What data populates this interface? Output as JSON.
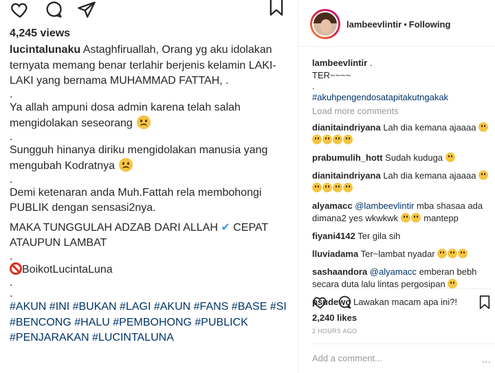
{
  "left": {
    "views": "4,245 views",
    "caption": {
      "username": "lucintalunaku",
      "p1": "Astaghfiruallah, Orang yg aku idolakan ternyata memang benar terlahir berjenis kelamin LAKI-LAKI yang bernama MUHAMMAD FATTAH, .",
      "p2": "Ya allah ampuni dosa admin karena telah salah mengidolakan seseorang",
      "p3": "Sungguh hinanya diriku mengidolakan manusia yang mengubah Kodratnya",
      "p4": "Demi ketenaran anda Muh.Fattah rela membohongi PUBLIK dengan sensasi2nya.",
      "p5a": "MAKA TUNGGULAH ADZAB DARI ALLAH",
      "p5b": "CEPAT ATAUPUN LAMBAT",
      "p6": "BoikotLucintaLuna",
      "dot": ".",
      "hashtags": "#AKUN #INI #BUKAN #LAGI #AKUN #FANS #BASE #SI #BENCONG #HALU #PEMBOHONG #PUBLICK #PENJARAKAN #LUCINTALUNA"
    },
    "icons": [
      "heart-icon",
      "comment-icon",
      "share-icon",
      "bookmark-icon"
    ]
  },
  "right": {
    "header": {
      "username": "lambeevlintir",
      "separator": "•",
      "following": "Following"
    },
    "caption": {
      "username": "lambeevlintir",
      "after_name": ".",
      "line2": "TER~~~~",
      "dot": ".",
      "hashtag": "#akuhpengendosatapitakutngakak"
    },
    "load_more": "Load more comments",
    "comments": [
      {
        "user": "dianitaindriyana",
        "text": "Lah dia kemana ajaaaa"
      },
      {
        "user": "prabumulih_hott",
        "text": "Sudah kuduga"
      },
      {
        "user": "dianitaindriyana",
        "text": "Lah dia kemana ajaaaa"
      },
      {
        "user": "alyamacc",
        "mention": "@lambeevlintir",
        "text": "mba shasaa ada dimana2 yes wkwkwk",
        "text2": "mantepp"
      },
      {
        "user": "fiyani4142",
        "text": "Ter gila sih"
      },
      {
        "user": "lluviadama",
        "text": "Ter~lambat nyadar"
      },
      {
        "user": "sashaandora",
        "mention": "@alyamacc",
        "text": "emberan bebh secara duta lalu lintas pergosipan"
      },
      {
        "user": "psudewo",
        "text": "Lawakan macam apa ini?!"
      }
    ],
    "likes": "2,240 likes",
    "time": "2 HOURS AGO",
    "add_comment_placeholder": "Add a comment...",
    "more": "..."
  }
}
